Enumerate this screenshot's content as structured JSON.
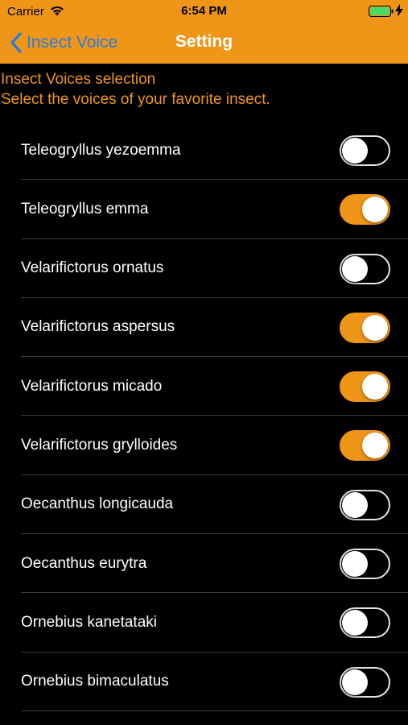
{
  "status_bar": {
    "carrier": "Carrier",
    "time": "6:54 PM",
    "wifi_icon": "wifi-icon",
    "battery_icon": "battery-icon",
    "battery_level": 1.0,
    "charging_icon": "bolt-icon"
  },
  "nav": {
    "back_label": "Insect Voice",
    "back_icon": "chevron-left-icon",
    "title": "Setting"
  },
  "section": {
    "line1": "Insect Voices selection",
    "line2": "Select the voices of your favorite insect."
  },
  "colors": {
    "accent": "#ef9518",
    "back_link": "#2a7de1",
    "background": "#000000"
  },
  "insects": [
    {
      "name": "Teleogryllus yezoemma",
      "enabled": false
    },
    {
      "name": "Teleogryllus emma",
      "enabled": true
    },
    {
      "name": "Velarifictorus ornatus",
      "enabled": false
    },
    {
      "name": "Velarifictorus aspersus",
      "enabled": true
    },
    {
      "name": "Velarifictorus micado",
      "enabled": true
    },
    {
      "name": "Velarifictorus grylloides",
      "enabled": true
    },
    {
      "name": "Oecanthus longicauda",
      "enabled": false
    },
    {
      "name": "Oecanthus eurytra",
      "enabled": false
    },
    {
      "name": "Ornebius kanetataki",
      "enabled": false
    },
    {
      "name": "Ornebius bimaculatus",
      "enabled": false
    }
  ]
}
